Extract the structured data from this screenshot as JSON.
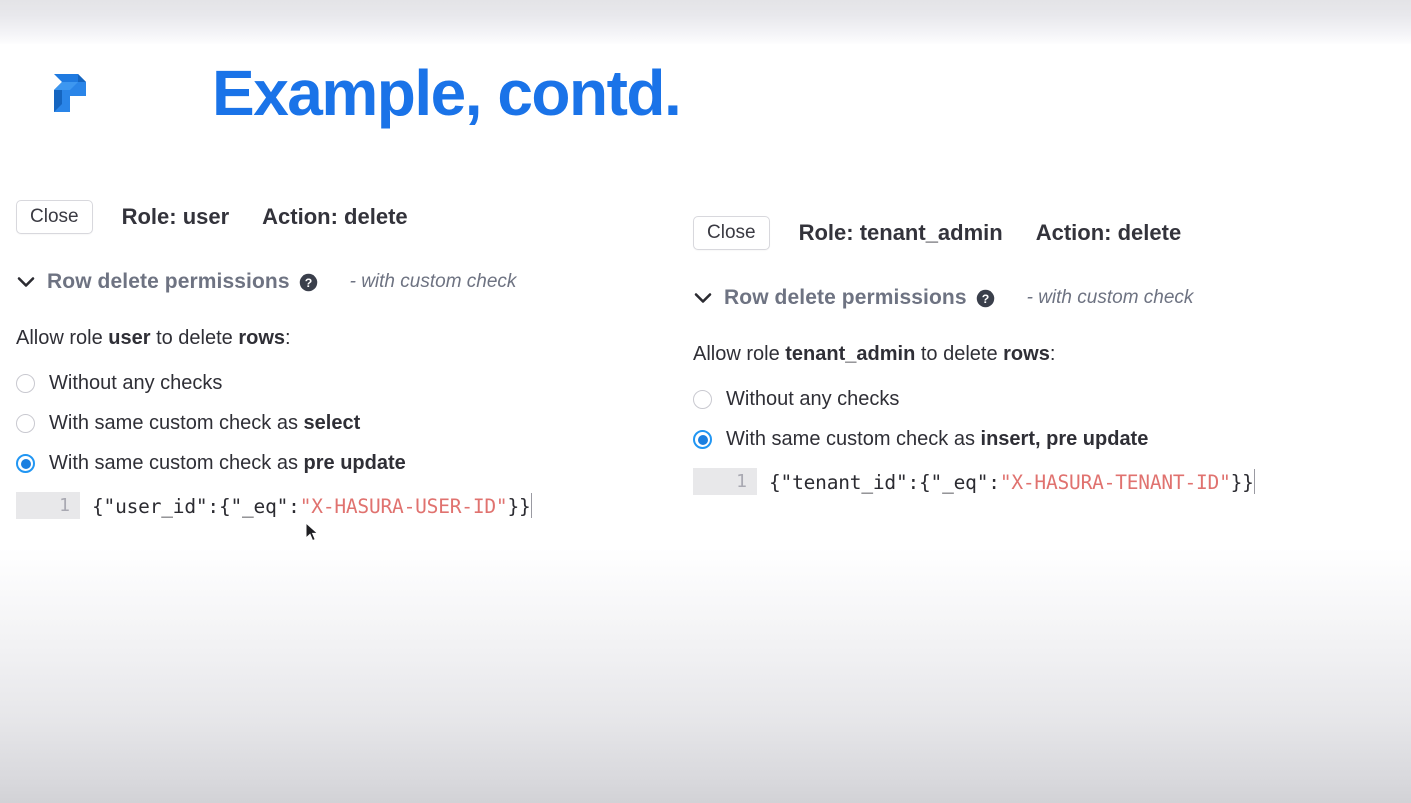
{
  "slide": {
    "title": "Example, contd.",
    "title_color": "#1a73e8",
    "logo_name": "hasura-logo"
  },
  "panels": [
    {
      "id": "left",
      "close_label": "Close",
      "role_label": "Role: user",
      "action_label": "Action: delete",
      "section_title": "Row delete permissions",
      "section_note": "- with custom check",
      "allow_prefix": "Allow role ",
      "allow_role": "user",
      "allow_middle": " to delete ",
      "allow_object": "rows",
      "allow_suffix": ":",
      "options": [
        {
          "label": "Without any checks",
          "bold": "",
          "selected": false
        },
        {
          "label": "With same custom check as ",
          "bold": "select",
          "selected": false
        },
        {
          "label": "With same custom check as ",
          "bold": "pre update",
          "selected": true
        }
      ],
      "code": {
        "line_number": "1",
        "prefix": "{\"user_id\":{\"_eq\":",
        "string": "\"X-HASURA-USER-ID\"",
        "suffix": "}}"
      }
    },
    {
      "id": "right",
      "close_label": "Close",
      "role_label": "Role: tenant_admin",
      "action_label": "Action: delete",
      "section_title": "Row delete permissions",
      "section_note": "- with custom check",
      "allow_prefix": "Allow role ",
      "allow_role": "tenant_admin",
      "allow_middle": " to delete ",
      "allow_object": "rows",
      "allow_suffix": ":",
      "options": [
        {
          "label": "Without any checks",
          "bold": "",
          "selected": false
        },
        {
          "label": "With same custom check as ",
          "bold": "insert, pre update",
          "selected": true
        }
      ],
      "code": {
        "line_number": "1",
        "prefix": "{\"tenant_id\":{\"_eq\":",
        "string": "\"X-HASURA-TENANT-ID\"",
        "suffix": "}}"
      }
    }
  ],
  "colors": {
    "accent_blue": "#1a73e8",
    "radio_selected": "#1b7fe0",
    "code_string": "#e0726f",
    "section_gray": "#6e7382"
  }
}
